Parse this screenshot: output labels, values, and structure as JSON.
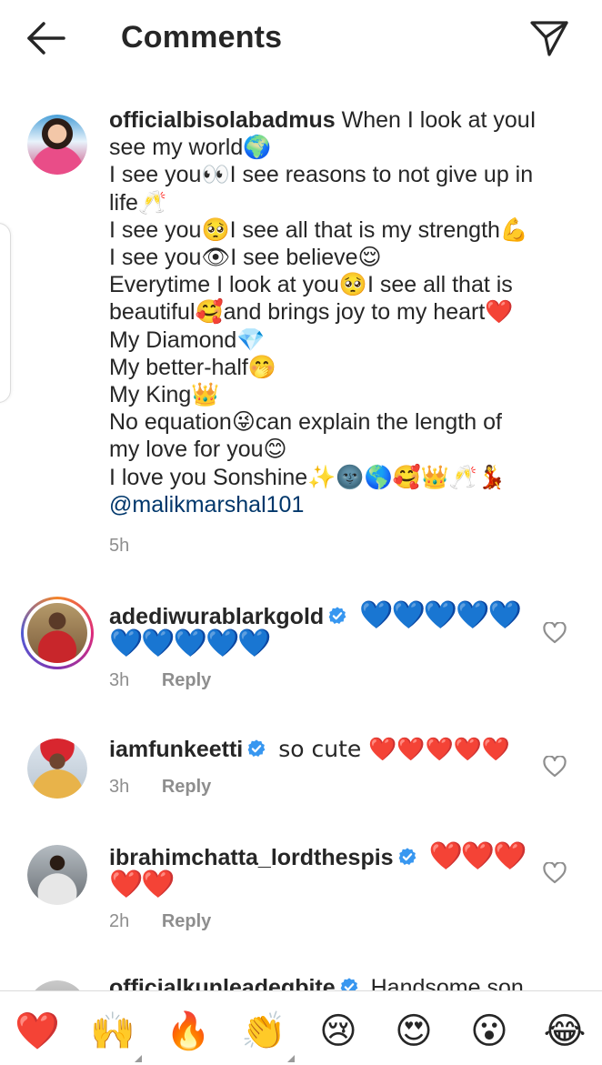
{
  "header": {
    "title": "Comments",
    "back_icon": "arrow-left-icon",
    "share_icon": "paper-plane-icon"
  },
  "caption": {
    "username": "officialbisolabadmus",
    "lines": [
      "When I look at you⁠I",
      "see my world🌍",
      "I see you👀I see reasons to not give up in",
      "life🥂",
      "I see you🥺I see all that is my strength💪",
      "I see you👁I see believe😌",
      "Everytime I look at you🥺I see all that is",
      "beautiful🥰and brings joy to my heart❤️",
      "My Diamond💎",
      "My better-half🤭",
      "My King👑",
      "No equation😜can explain the length of",
      "my love for you😊",
      " I love you Sonshine✨🌚🌎🥰👑🥂💃"
    ],
    "mention": "@malikmarshal101",
    "time": "5h"
  },
  "comments": [
    {
      "username": "adediwurablarkgold",
      "verified": true,
      "text_line1": "💙💙💙💙💙",
      "text_line2": "💙💙💙💙💙",
      "time": "3h",
      "reply": "Reply"
    },
    {
      "username": "iamfunkeetti",
      "verified": true,
      "text_line1": "so cute ❤️❤️❤️❤️❤️",
      "time": "3h",
      "reply": "Reply"
    },
    {
      "username": "ibrahimchatta_lordthespis",
      "verified": true,
      "text_line1": "❤️❤️❤️",
      "text_line2": "❤️❤️",
      "time": "2h",
      "reply": "Reply"
    },
    {
      "username": "officialkunleadegbite",
      "verified": true,
      "text_line1": "Handsome son"
    }
  ],
  "reactions": [
    "❤️",
    "🙌",
    "🔥",
    "👏",
    "😢",
    "😍",
    "😮",
    "😂"
  ],
  "colors": {
    "link": "#00376b",
    "meta": "#8e8e8e",
    "verified": "#3897f0",
    "blue_heart": "#2f7ee0",
    "red_heart": "#e02330"
  }
}
